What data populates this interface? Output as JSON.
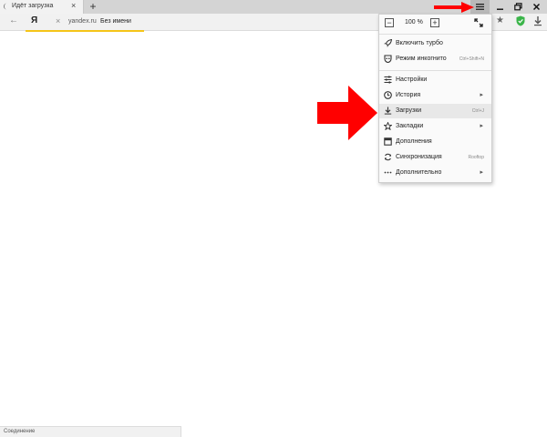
{
  "tab": {
    "title": "Идёт загрузка"
  },
  "address": {
    "host": "yandex.ru",
    "page_title": "Без имени",
    "logo": "Я"
  },
  "zoom": {
    "value": "100 %"
  },
  "menu": {
    "items": [
      {
        "label": "Включить турбо",
        "icon": "rocket-icon",
        "shortcut": "",
        "submenu": false
      },
      {
        "label": "Режим инкогнито",
        "icon": "incognito-icon",
        "shortcut": "Ctrl+Shift+N",
        "submenu": false
      },
      {
        "label": "Настройки",
        "icon": "settings-sliders-icon",
        "shortcut": "",
        "submenu": false
      },
      {
        "label": "История",
        "icon": "clock-icon",
        "shortcut": "",
        "submenu": true
      },
      {
        "label": "Загрузки",
        "icon": "download-icon",
        "shortcut": "Ctrl+J",
        "submenu": false
      },
      {
        "label": "Закладки",
        "icon": "star-icon",
        "shortcut": "",
        "submenu": true
      },
      {
        "label": "Дополнения",
        "icon": "extensions-icon",
        "shortcut": "",
        "submenu": false
      },
      {
        "label": "Синхронизация",
        "icon": "sync-icon",
        "shortcut": "Rooftop",
        "submenu": false
      },
      {
        "label": "Дополнительно",
        "icon": "more-icon",
        "shortcut": "",
        "submenu": true
      }
    ]
  },
  "status": {
    "text": "Соединение"
  },
  "colors": {
    "accent_yellow": "#f5c518",
    "arrow_red": "#ff0000",
    "shield_green": "#3bb54a"
  }
}
